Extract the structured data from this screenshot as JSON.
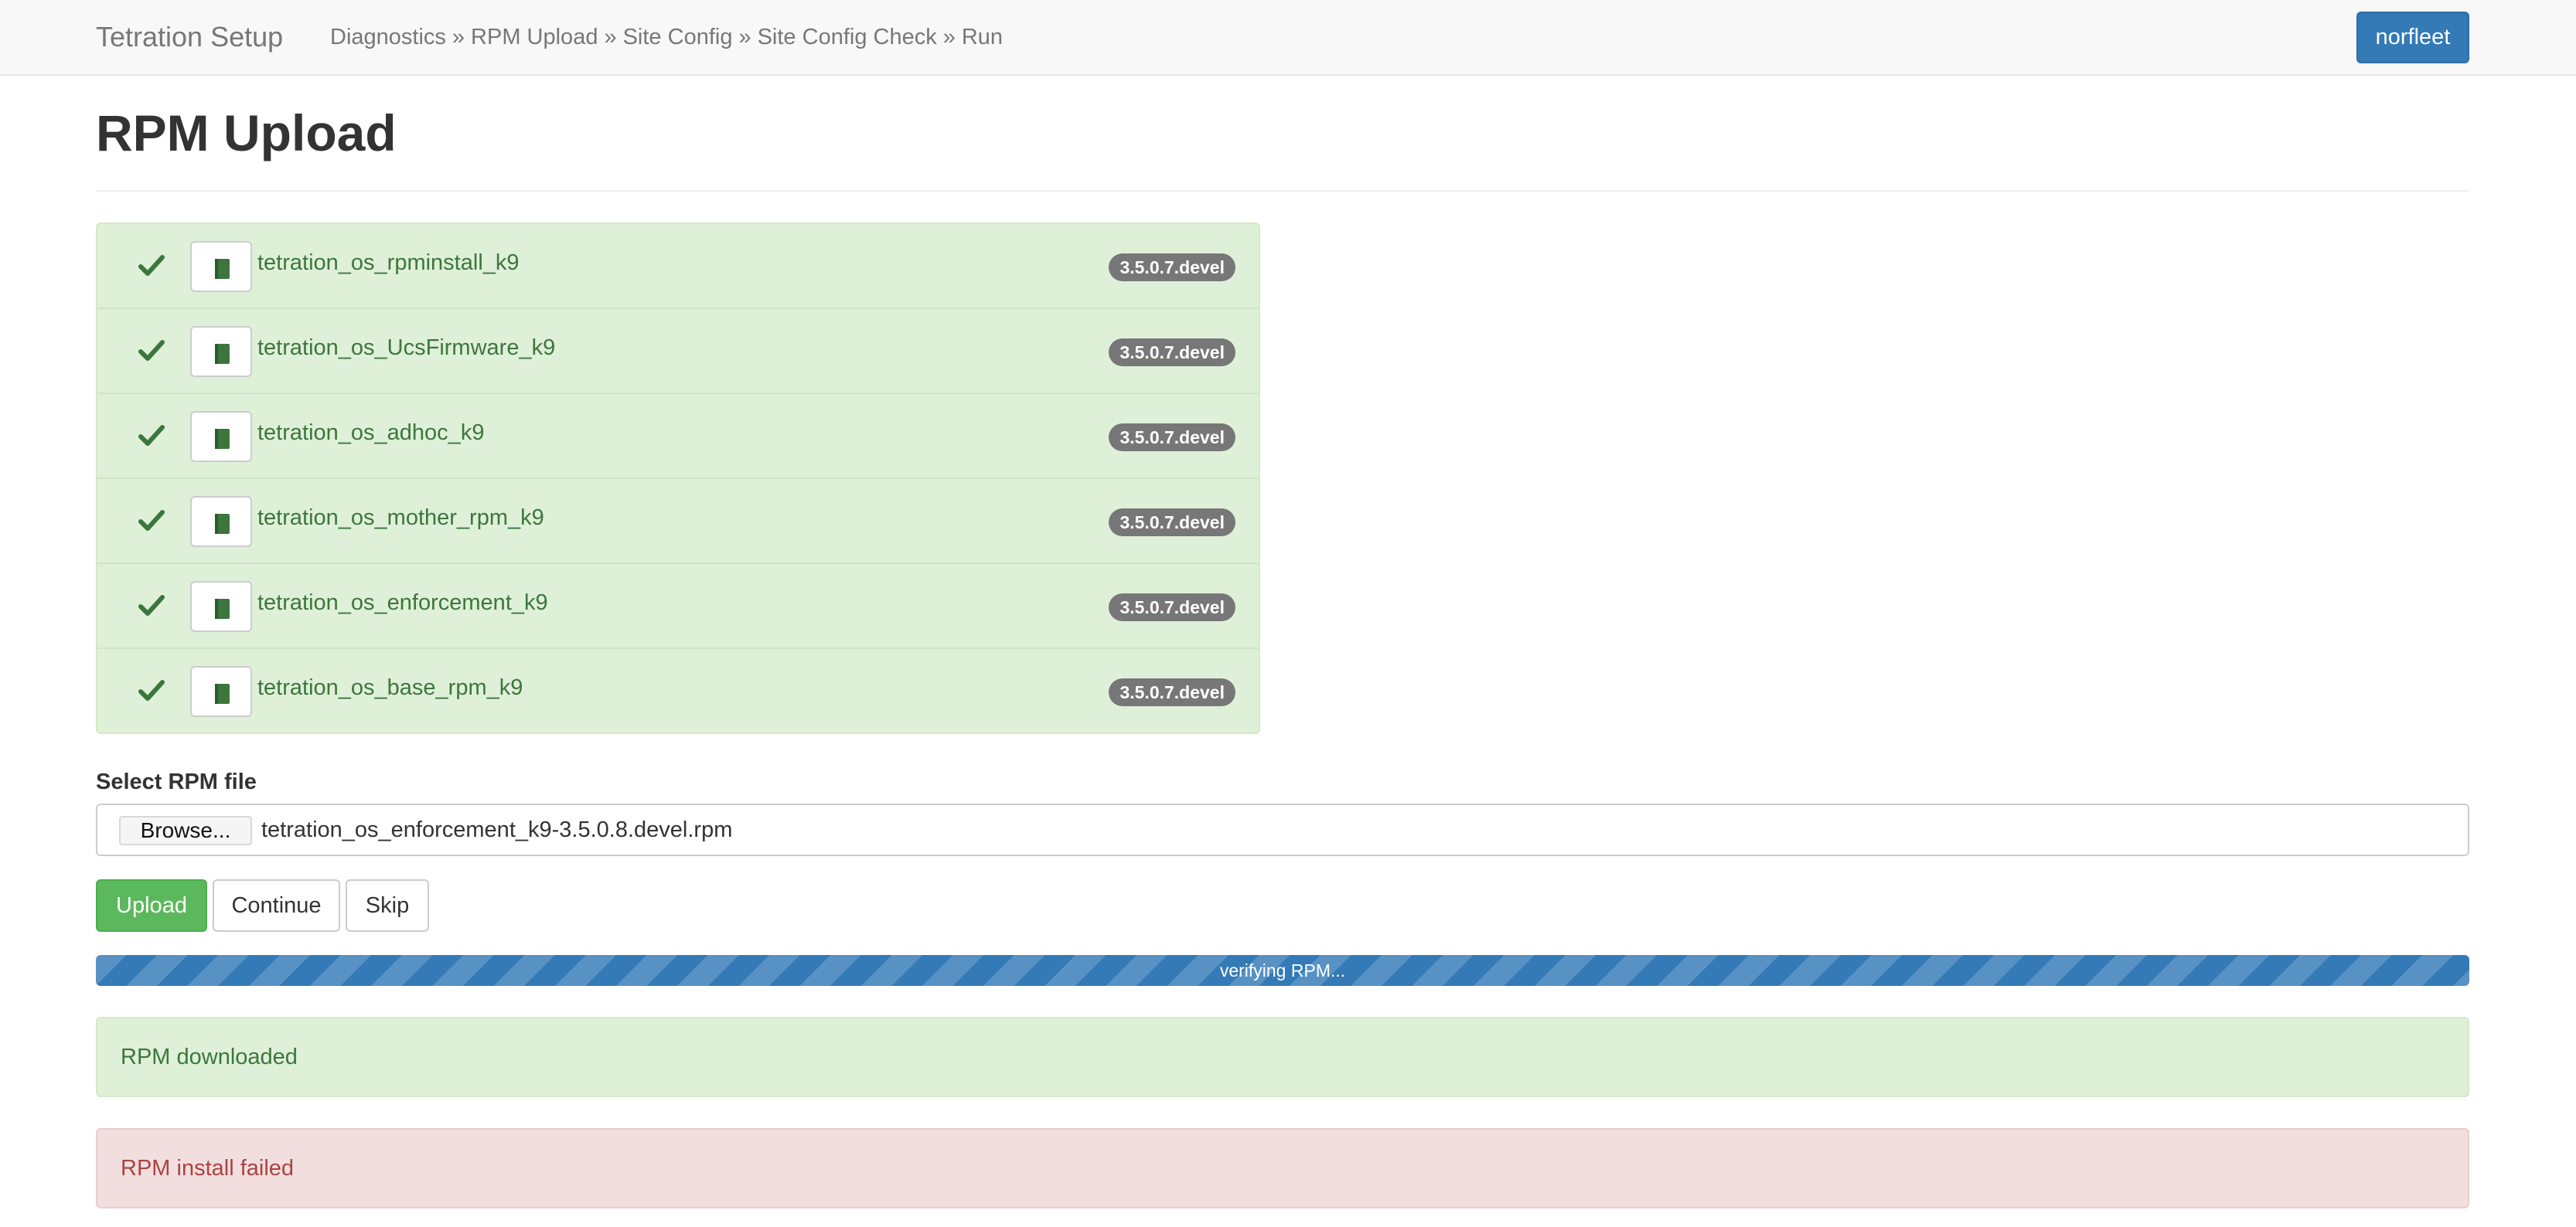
{
  "navbar": {
    "brand": "Tetration Setup",
    "breadcrumbs": [
      "Diagnostics",
      "RPM Upload",
      "Site Config",
      "Site Config Check",
      "Run"
    ],
    "separator": "»",
    "user_button": "norfleet"
  },
  "page": {
    "title": "RPM Upload"
  },
  "rpms": [
    {
      "name": "tetration_os_rpminstall_k9",
      "version": "3.5.0.7.devel",
      "status_icon": "check-icon",
      "file_icon": "book-icon"
    },
    {
      "name": "tetration_os_UcsFirmware_k9",
      "version": "3.5.0.7.devel",
      "status_icon": "check-icon",
      "file_icon": "book-icon"
    },
    {
      "name": "tetration_os_adhoc_k9",
      "version": "3.5.0.7.devel",
      "status_icon": "check-icon",
      "file_icon": "book-icon"
    },
    {
      "name": "tetration_os_mother_rpm_k9",
      "version": "3.5.0.7.devel",
      "status_icon": "check-icon",
      "file_icon": "book-icon"
    },
    {
      "name": "tetration_os_enforcement_k9",
      "version": "3.5.0.7.devel",
      "status_icon": "check-icon",
      "file_icon": "book-icon"
    },
    {
      "name": "tetration_os_base_rpm_k9",
      "version": "3.5.0.7.devel",
      "status_icon": "check-icon",
      "file_icon": "book-icon"
    }
  ],
  "upload_form": {
    "label": "Select RPM file",
    "browse_label": "Browse...",
    "selected_file": "tetration_os_enforcement_k9-3.5.0.8.devel.rpm",
    "buttons": {
      "upload": "Upload",
      "continue": "Continue",
      "skip": "Skip"
    }
  },
  "progress": {
    "label": "verifying RPM...",
    "percent": 100,
    "striped": true,
    "color": "#337ab7"
  },
  "alerts": {
    "success": "RPM downloaded",
    "danger": "RPM install failed"
  },
  "colors": {
    "primary": "#337ab7",
    "success": "#5cb85c",
    "success_bg": "#dff0d8",
    "success_text": "#3c763d",
    "danger_bg": "#f2dede",
    "danger_text": "#a94442",
    "badge": "#777777"
  }
}
